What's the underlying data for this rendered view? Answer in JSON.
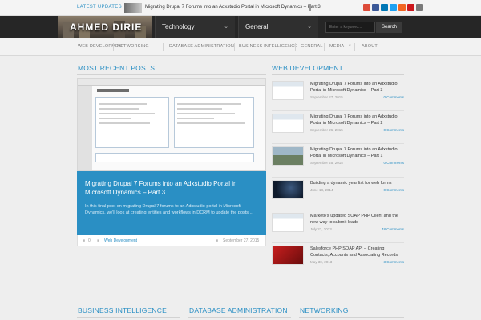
{
  "topbar": {
    "latest_label": "LATEST UPDATES",
    "latest_headline": "Migrating Drupal 7 Forums into an Adxstudio Portal in Microsoft Dynamics – Part 3",
    "social_icons": [
      {
        "name": "google-plus-icon",
        "color": "#dd4b39"
      },
      {
        "name": "facebook-icon",
        "color": "#3b5998"
      },
      {
        "name": "linkedin-icon",
        "color": "#0077b5"
      },
      {
        "name": "twitter-icon",
        "color": "#1da1f2"
      },
      {
        "name": "rss-icon",
        "color": "#f26522"
      },
      {
        "name": "youtube-icon",
        "color": "#cc181e"
      },
      {
        "name": "email-icon",
        "color": "#7a7a7a"
      }
    ]
  },
  "header": {
    "logo_text": "AHMED DIRIE",
    "dropdowns": [
      {
        "label": "Technology",
        "chevron": "chevron-down-icon"
      },
      {
        "label": "General",
        "chevron": "chevron-down-icon"
      }
    ],
    "search": {
      "placeholder": "Enter a keyword...",
      "button_label": "Search"
    }
  },
  "nav": {
    "items": [
      {
        "label": "WEB DEVELOPMENT"
      },
      {
        "label": "NETWORKING"
      },
      {
        "label": "DATABASE ADMINISTRATION"
      },
      {
        "label": "BUSINESS INTELLIGENCE"
      },
      {
        "label": "GENERAL"
      },
      {
        "label": "MEDIA"
      },
      {
        "label": "ABOUT"
      }
    ],
    "media_chevron": "⌄"
  },
  "sections": {
    "most_recent": "MOST RECENT POSTS",
    "web_dev": "WEB DEVELOPMENT",
    "bi": "BUSINESS INTELLIGENCE",
    "dba": "DATABASE ADMINISTRATION",
    "networking": "NETWORKING"
  },
  "featured": {
    "title": "Migrating Drupal 7 Forums into an Adxstudio Portal in Microsoft Dynamics – Part 3",
    "excerpt": "In this final post on migrating Drupal 7 forums to an Adxstudio portal in Microsoft Dynamics, we'll look at creating entities and workflows in DCRM to update the posts...",
    "comments": "0",
    "category": "Web Development",
    "date": "September 27, 2015"
  },
  "web_dev_posts": [
    {
      "title": "Migrating Drupal 7 Forums into an Adxstudio Portal in Microsoft Dynamics – Part 3",
      "date": "September 27, 2015",
      "comments": "0 Comments",
      "thumb": "screenshot"
    },
    {
      "title": "Migrating Drupal 7 Forums into an Adxstudio Portal in Microsoft Dynamics – Part 2",
      "date": "September 26, 2015",
      "comments": "0 Comments",
      "thumb": "screenshot"
    },
    {
      "title": "Migrating Drupal 7 Forums into an Adxstudio Portal in Microsoft Dynamics – Part 1",
      "date": "September 25, 2015",
      "comments": "0 Comments",
      "thumb": "landscape"
    },
    {
      "title": "Building a dynamic year list for web forms",
      "date": "June 18, 2014",
      "comments": "0 Comments",
      "thumb": "dark"
    },
    {
      "title": "Marketo's updated SOAP PHP Client and the new way to submit leads",
      "date": "July 23, 2013",
      "comments": "48 Comments",
      "thumb": "screenshot"
    },
    {
      "title": "Salesforce PHP SOAP API – Creating Contacts, Accounts and Associating Records",
      "date": "May 30, 2013",
      "comments": "3 Comments",
      "thumb": "red"
    }
  ]
}
